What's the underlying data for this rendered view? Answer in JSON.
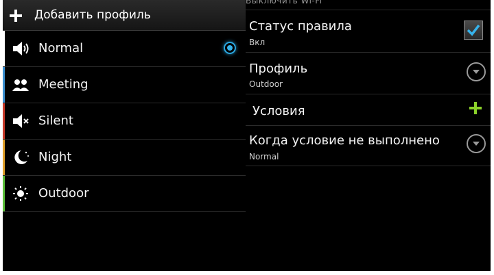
{
  "left": {
    "header_title": "Добавить профиль",
    "profiles": [
      {
        "label": "Normal",
        "icon": "speaker-icon",
        "accent": "#ffffff",
        "selected": true
      },
      {
        "label": "Meeting",
        "icon": "people-icon",
        "accent": "#3a8fd0",
        "selected": false
      },
      {
        "label": "Silent",
        "icon": "mute-icon",
        "accent": "#c83a2a",
        "selected": false
      },
      {
        "label": "Night",
        "icon": "moon-icon",
        "accent": "#e0a02a",
        "selected": false
      },
      {
        "label": "Outdoor",
        "icon": "sun-icon",
        "accent": "#5bbf3a",
        "selected": false
      }
    ]
  },
  "right": {
    "cut_header": "Выключить Wi-Fi",
    "rule_status": {
      "title": "Статус правила",
      "value": "Вкл",
      "checked": true
    },
    "profile": {
      "title": "Профиль",
      "value": "Outdoor"
    },
    "conditions": {
      "title": "Условия"
    },
    "when_unmet": {
      "title": "Когда условие не выполнено",
      "value": "Normal"
    }
  },
  "colors": {
    "selection": "#36b3ec",
    "add_green": "#8bd12a"
  }
}
